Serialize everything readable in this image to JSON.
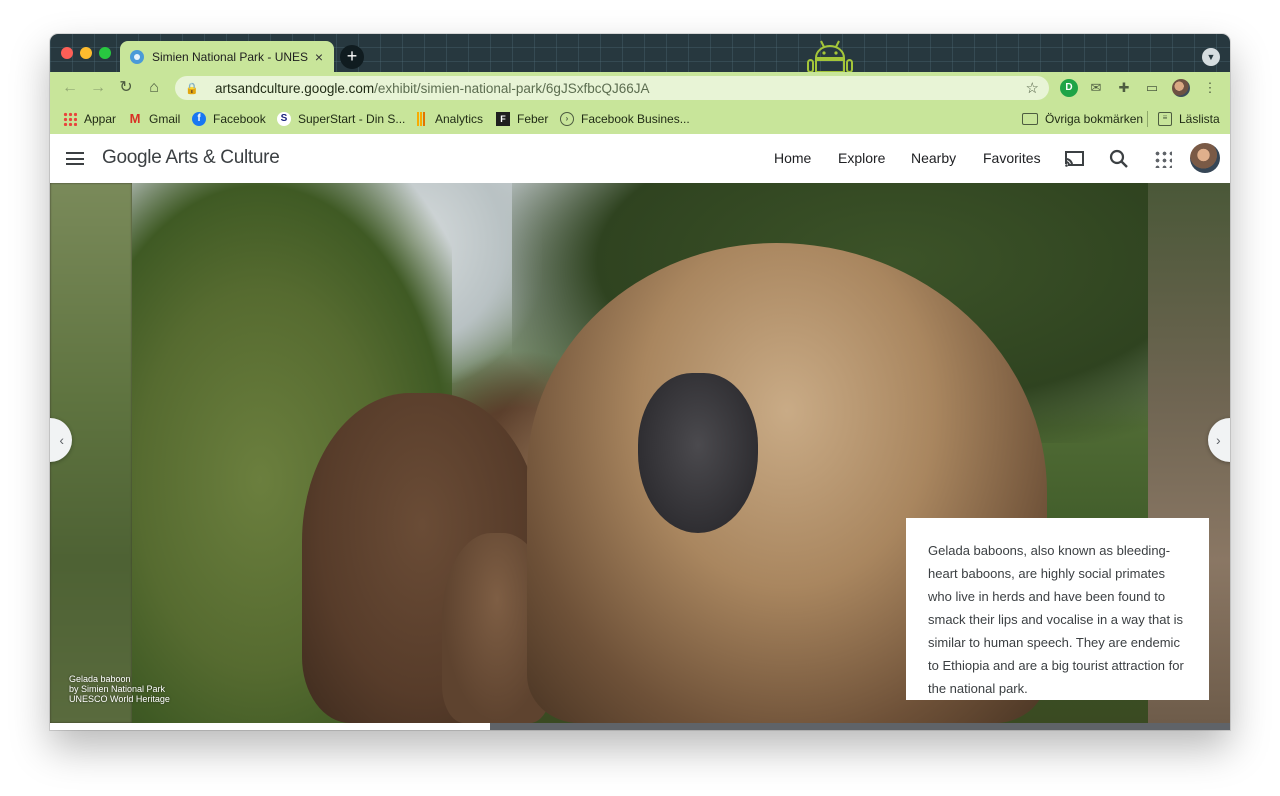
{
  "browser": {
    "tab_title": "Simien National Park - UNESCO",
    "tab_close": "×",
    "new_tab": "+",
    "url_host": "artsandculture.google.com",
    "url_path": "/exhibit/simien-national-park/6gJSxfbcQJ66JA"
  },
  "bookmarks": {
    "items": [
      {
        "label": "Appar",
        "icon": "apps-grid-icon"
      },
      {
        "label": "Gmail",
        "icon": "gmail-icon"
      },
      {
        "label": "Facebook",
        "icon": "facebook-icon"
      },
      {
        "label": "SuperStart - Din S...",
        "icon": "superstart-icon"
      },
      {
        "label": "Analytics",
        "icon": "analytics-icon"
      },
      {
        "label": "Feber",
        "icon": "feber-icon"
      },
      {
        "label": "Facebook Busines...",
        "icon": "facebook-business-icon"
      }
    ],
    "other": "Övriga bokmärken",
    "reading_list": "Läslista"
  },
  "site": {
    "logo": "Google Arts & Culture",
    "nav": [
      "Home",
      "Explore",
      "Nearby",
      "Favorites"
    ]
  },
  "slide": {
    "caption_title": "Gelada baboon",
    "caption_by": "by Simien National Park",
    "caption_source": "UNESCO World Heritage",
    "description": "Gelada baboons, also known as bleeding-heart baboons, are highly social primates who live in herds and have been found to smack their lips and vocalise in a way that is similar to human speech. They are endemic to Ethiopia and are a big tourist attraction for the national park.",
    "progress": 0.373
  },
  "colors": {
    "theme_green": "#c8e59a",
    "tab_strip": "#27383f"
  }
}
